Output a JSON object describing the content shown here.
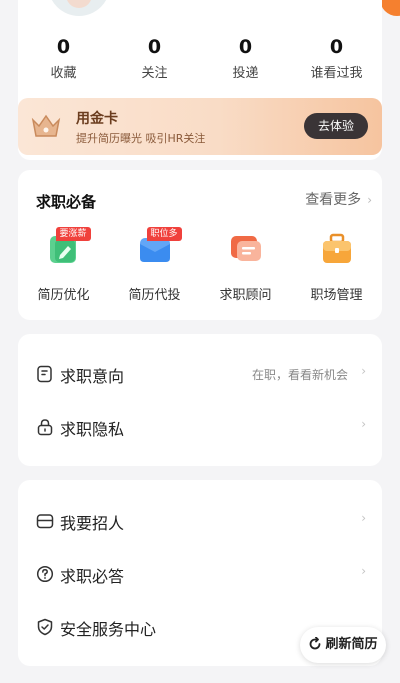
{
  "profile": {
    "stats": [
      {
        "value": "0",
        "label": "收藏"
      },
      {
        "value": "0",
        "label": "关注"
      },
      {
        "value": "0",
        "label": "投递"
      },
      {
        "value": "0",
        "label": "谁看过我"
      }
    ]
  },
  "gold_card": {
    "title": "用金卡",
    "subtitle": "提升简历曝光 吸引HR关注",
    "button_label": "去体验",
    "icon": "crown-icon"
  },
  "essentials": {
    "title": "求职必备",
    "more_label": "查看更多",
    "tools": [
      {
        "label": "简历优化",
        "tag": "要涨薪",
        "icon": "resume-edit-icon",
        "color": "#3fbf78"
      },
      {
        "label": "简历代投",
        "tag": "职位多",
        "icon": "send-resume-icon",
        "color": "#3b8cf0"
      },
      {
        "label": "求职顾问",
        "tag": "",
        "icon": "consultant-chat-icon",
        "color": "#f06a45"
      },
      {
        "label": "职场管理",
        "tag": "",
        "icon": "briefcase-icon",
        "color": "#f7a63a"
      }
    ]
  },
  "intent_section": {
    "items": [
      {
        "label": "求职意向",
        "value": "在职，看看新机会",
        "icon": "job-intent-icon"
      },
      {
        "label": "求职隐私",
        "value": "",
        "icon": "lock-icon"
      }
    ]
  },
  "service_section": {
    "items": [
      {
        "label": "我要招人",
        "icon": "recruit-icon"
      },
      {
        "label": "求职必答",
        "icon": "question-icon"
      },
      {
        "label": "安全服务中心",
        "icon": "shield-icon"
      }
    ]
  },
  "refresh_button": {
    "label": "刷新简历",
    "icon": "refresh-icon"
  },
  "colors": {
    "accent": "#f5802f",
    "tag_red": "#f0413c",
    "gold_dark": "#3a3436"
  }
}
